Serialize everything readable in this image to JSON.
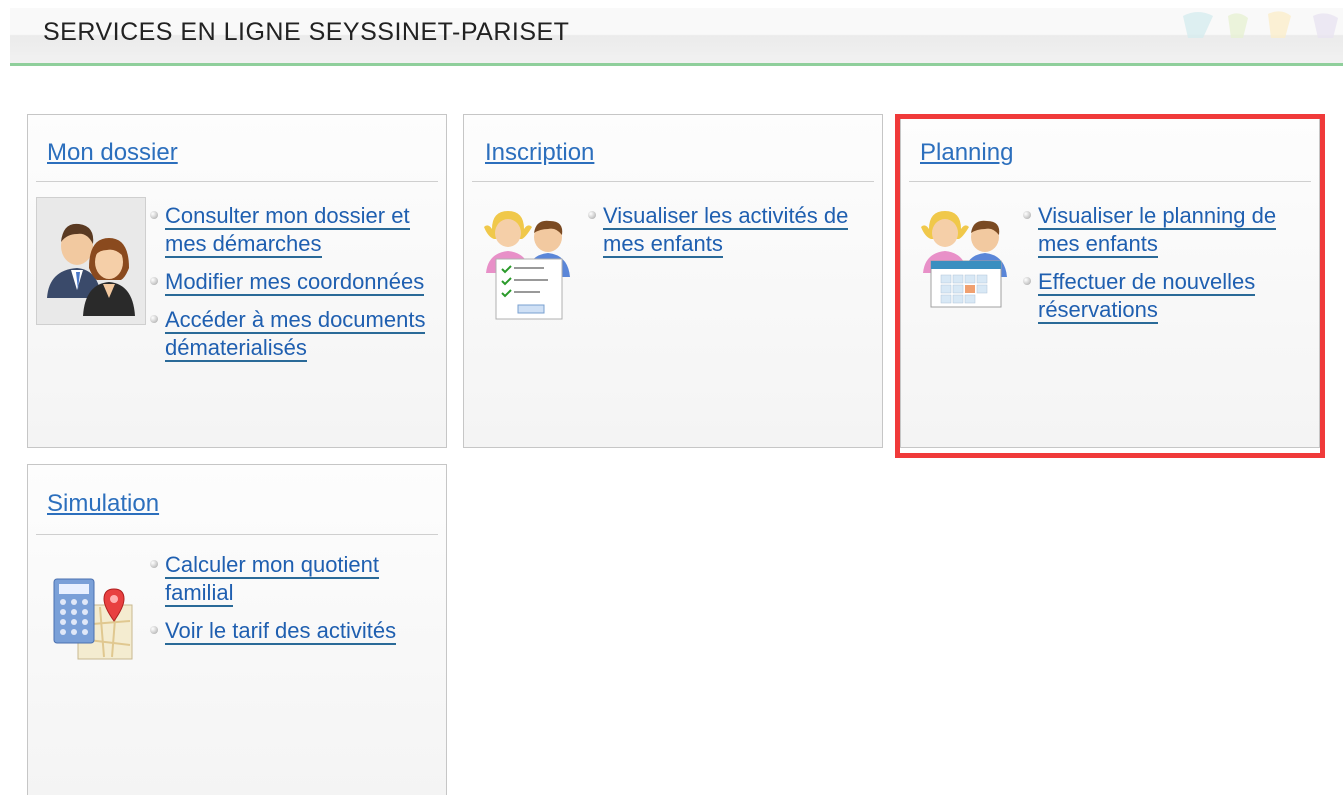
{
  "header": {
    "title": "SERVICES EN LIGNE SEYSSINET-PARISET"
  },
  "tiles": {
    "mon_dossier": {
      "title": "Mon dossier",
      "links": [
        "Consulter mon dossier et mes démarches",
        "Modifier mes coordonnées",
        "Accéder à mes documents dématerialisés"
      ]
    },
    "inscription": {
      "title": "Inscription",
      "links": [
        "Visualiser les activités de mes enfants"
      ]
    },
    "planning": {
      "title": "Planning",
      "links": [
        "Visualiser le planning de mes enfants",
        "Effectuer de nouvelles réservations"
      ]
    },
    "simulation": {
      "title": "Simulation",
      "links": [
        "Calculer mon quotient familial",
        "Voir le tarif des activités"
      ]
    }
  },
  "colors": {
    "link": "#1f5fb0",
    "header_rule": "#8fcf9b",
    "highlight": "#f03a3a"
  },
  "icons": [
    "users-icon",
    "children-checklist-icon",
    "children-calendar-icon",
    "calculator-map-icon"
  ]
}
